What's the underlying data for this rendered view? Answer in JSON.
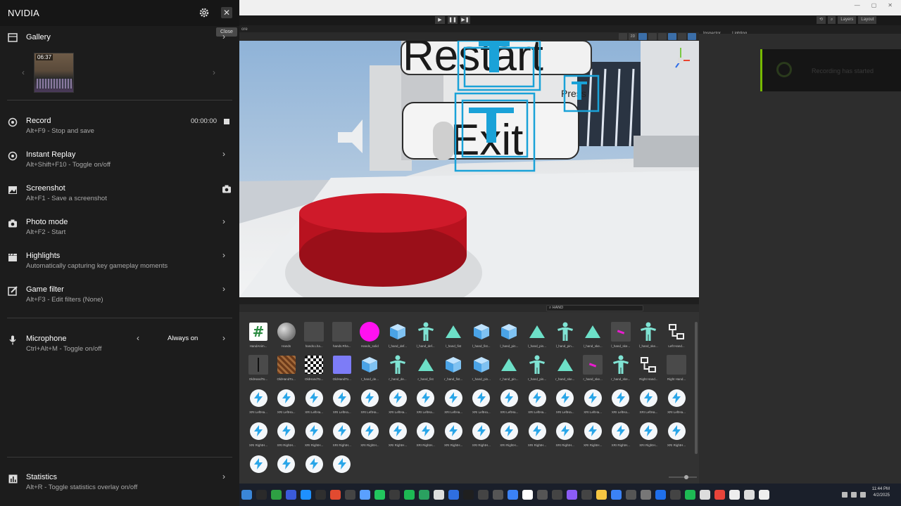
{
  "nvidia": {
    "title": "NVIDIA",
    "close_tooltip": "Close",
    "gallery": {
      "label": "Gallery",
      "thumbnail_duration": "06:37"
    },
    "items": [
      {
        "id": "record",
        "label": "Record",
        "sub": "Alt+F9 - Stop and save",
        "time": "00:00:00"
      },
      {
        "id": "instant-replay",
        "label": "Instant Replay",
        "sub": "Alt+Shift+F10 - Toggle on/off"
      },
      {
        "id": "screenshot",
        "label": "Screenshot",
        "sub": "Alt+F1 - Save a screenshot"
      },
      {
        "id": "photo-mode",
        "label": "Photo mode",
        "sub": "Alt+F2 - Start"
      },
      {
        "id": "highlights",
        "label": "Highlights",
        "sub": "Automatically capturing key gameplay moments"
      },
      {
        "id": "game-filter",
        "label": "Game filter",
        "sub": "Alt+F3 - Edit filters (None)"
      },
      {
        "id": "microphone",
        "label": "Microphone",
        "sub": "Ctrl+Alt+M - Toggle on/off",
        "value": "Always on"
      },
      {
        "id": "statistics",
        "label": "Statistics",
        "sub": "Alt+R - Toggle statistics overlay on/off"
      }
    ],
    "accent": "#76b900"
  },
  "unity": {
    "scene_tab": "ore",
    "toolbar_right": [
      "Layers",
      "Layout"
    ],
    "scene_2d": "2D",
    "inspector_tabs": [
      "Inspector",
      "Lighting"
    ],
    "search_value": "HAND",
    "scene_text": {
      "restart": "Restart",
      "exit": "Exit",
      "press": "Press"
    },
    "toast": "Recording has started",
    "assets_row1": [
      "HandAnim...",
      "Hands",
      "hands.Lha...",
      "hands.Rha...",
      "Hands_solid",
      "l_hand_def...",
      "l_hand_def...",
      "l_hand_fist",
      "l_hand_fist...",
      "l_hand_pin...",
      "l_hand_pin...",
      "l_hand_pin...",
      "l_hand_ske...",
      "l_hand_ske...",
      "l_hand_ske...",
      "Left Hand..."
    ],
    "assets_row2": [
      "OldHandTo...",
      "OldHandTo...",
      "OldHandTo...",
      "OldHandTo...",
      "r_hand_de...",
      "r_hand_de...",
      "r_hand_fist",
      "r_hand_fist...",
      "r_hand_pin...",
      "r_hand_pin...",
      "r_hand_pin...",
      "r_hand_ske...",
      "r_hand_ske...",
      "r_hand_ske...",
      "Right Hand...",
      "Right Hand..."
    ],
    "assets_row3": [
      "XRI LeftHa...",
      "XRI LeftHa...",
      "XRI LeftHa...",
      "XRI LeftHa...",
      "XRI LeftHa...",
      "XRI LeftHa...",
      "XRI LeftHa...",
      "XRI LeftHa...",
      "XRI LeftHa...",
      "XRI LeftHa...",
      "XRI LeftHa...",
      "XRI LeftHa...",
      "XRI LeftHa...",
      "XRI LeftHa...",
      "XRI LeftHa...",
      "XRI LeftHa..."
    ],
    "assets_row4": [
      "XRI RightH...",
      "XRI RightH...",
      "XRI RightH...",
      "XRI RightH...",
      "XRI RightH...",
      "XRI RightH...",
      "XRI RightH...",
      "XRI RightH...",
      "XRI RightH...",
      "XRI RightH...",
      "XRI RightH...",
      "XRI RightH...",
      "XRI RightH...",
      "XRI RightH...",
      "XRI RightH...",
      "XRI RightH..."
    ],
    "assets_row5_count": 4
  },
  "taskbar": {
    "time": "11:44 PM",
    "date": "4/2/2025"
  }
}
